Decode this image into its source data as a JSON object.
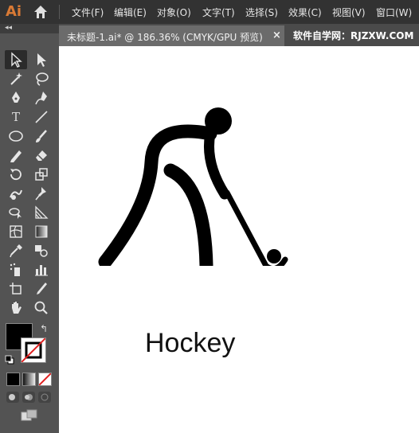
{
  "app": {
    "logo_text": "Ai"
  },
  "menu": [
    "文件(F)",
    "编辑(E)",
    "对象(O)",
    "文字(T)",
    "选择(S)",
    "效果(C)",
    "视图(V)",
    "窗口(W)"
  ],
  "tabs": [
    {
      "label": "未标题-1.ai* @ 186.36% (CMYK/GPU 预览)",
      "close": "×"
    }
  ],
  "watermark": "软件自学网：RJZXW.COM",
  "toolbox": {
    "collapse_glyph": "◂◂",
    "tools": [
      "selection-tool",
      "direct-selection-tool",
      "magic-wand-tool",
      "lasso-tool",
      "pen-tool",
      "curvature-tool",
      "type-tool",
      "line-segment-tool",
      "ellipse-tool",
      "paintbrush-tool",
      "shaper-tool",
      "eraser-tool",
      "rotate-tool",
      "scale-tool",
      "warp-tool",
      "free-transform-tool",
      "shape-builder-tool",
      "perspective-grid-tool",
      "mesh-tool",
      "gradient-tool",
      "eyedropper-tool",
      "blend-tool",
      "symbol-sprayer-tool",
      "column-graph-tool",
      "artboard-tool",
      "slice-tool",
      "hand-tool",
      "zoom-tool"
    ],
    "type_tool_glyph": "T",
    "fill_color": "#000000",
    "stroke": "none",
    "swap_glyph": "↰"
  },
  "colors": {
    "menubar": "#323232",
    "panel": "#535353",
    "accent_logo": "#d97a35"
  },
  "canvas": {
    "caption": "Hockey"
  }
}
